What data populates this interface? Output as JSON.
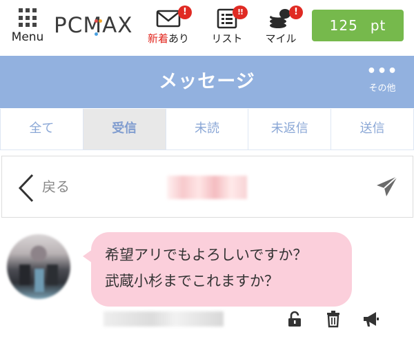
{
  "header": {
    "menu_label": "Menu",
    "logo_text": "PCMAX",
    "logo_dot_colors": [
      "#e24b4b",
      "#f0a830",
      "#4aa0e0"
    ],
    "nav": [
      {
        "name": "new-arrivals",
        "label_highlight": "新着",
        "label_rest": "あり",
        "badge": "!",
        "icon": "envelope-icon"
      },
      {
        "name": "list",
        "label": "リスト",
        "badge": "!!",
        "icon": "list-icon"
      },
      {
        "name": "mile",
        "label": "マイル",
        "badge": "!",
        "icon": "coins-icon"
      }
    ],
    "points_value": "125",
    "points_unit": "pt"
  },
  "title_bar": {
    "title": "メッセージ",
    "more_label": "その他",
    "more_icon": "ellipsis-icon"
  },
  "tabs": [
    {
      "label": "全て",
      "active": false
    },
    {
      "label": "受信",
      "active": true
    },
    {
      "label": "未読",
      "active": false
    },
    {
      "label": "未返信",
      "active": false
    },
    {
      "label": "送信",
      "active": false
    }
  ],
  "back_bar": {
    "back_label": "戻る",
    "partner_name": "",
    "send_icon": "paper-plane-icon"
  },
  "message": {
    "lines": [
      "希望アリでもよろしいですか？",
      "武蔵小杉までこれますか？"
    ],
    "actions": [
      "unlock-icon",
      "trash-icon",
      "megaphone-icon"
    ]
  },
  "colors": {
    "accent_blue": "#92b1df",
    "points_green": "#76b94c",
    "badge_red": "#e02a23",
    "bubble_pink": "#fbcfdb",
    "active_tab_bg": "#e8e8e8"
  }
}
